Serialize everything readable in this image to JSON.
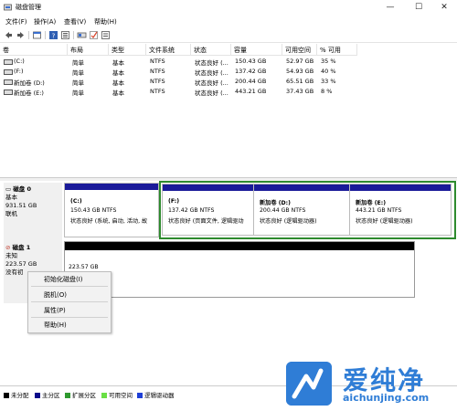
{
  "window": {
    "title": "磁盘管理",
    "minimize": "—",
    "maximize": "☐",
    "close": "✕"
  },
  "menu": [
    "文件(F)",
    "操作(A)",
    "查看(V)",
    "帮助(H)"
  ],
  "toolbar_icons": [
    "back-icon",
    "forward-icon",
    "properties-icon",
    "help-icon",
    "refresh-icon",
    "rescan-icon",
    "check-icon",
    "list-icon"
  ],
  "columns": [
    "卷",
    "布局",
    "类型",
    "文件系统",
    "状态",
    "容量",
    "可用空间",
    "% 可用"
  ],
  "volumes": [
    [
      "(C:)",
      "简单",
      "基本",
      "NTFS",
      "状态良好 (...",
      "150.43 GB",
      "52.97 GB",
      "35 %"
    ],
    [
      "(F:)",
      "简单",
      "基本",
      "NTFS",
      "状态良好 (...",
      "137.42 GB",
      "54.93 GB",
      "40 %"
    ],
    [
      "新加卷 (D:)",
      "简单",
      "基本",
      "NTFS",
      "状态良好 (...",
      "200.44 GB",
      "65.51 GB",
      "33 %"
    ],
    [
      "新加卷 (E:)",
      "简单",
      "基本",
      "NTFS",
      "状态良好 (...",
      "443.21 GB",
      "37.43 GB",
      "8 %"
    ]
  ],
  "disk0": {
    "name": "磁盘 0",
    "type": "基本",
    "size": "931.51 GB",
    "status": "联机",
    "partitions": [
      {
        "name": "(C:)",
        "size": "150.43 GB NTFS",
        "status": "状态良好 (系统, 启动, 活动, 故"
      },
      {
        "name": "(F:)",
        "size": "137.42 GB NTFS",
        "status": "状态良好 (页面文件, 逻辑驱动"
      },
      {
        "name": "新加卷  (D:)",
        "size": "200.44 GB NTFS",
        "status": "状态良好 (逻辑驱动器)"
      },
      {
        "name": "新加卷  (E:)",
        "size": "443.21 GB NTFS",
        "status": "状态良好 (逻辑驱动器)"
      }
    ]
  },
  "disk1": {
    "name": "磁盘 1",
    "type": "未知",
    "size": "223.57 GB",
    "status": "没有初",
    "unallocated": "223.57 GB"
  },
  "context_menu": [
    "初始化磁盘(I)",
    "脱机(O)",
    "属性(P)",
    "帮助(H)"
  ],
  "legend": [
    {
      "label": "未分配",
      "color": "#000000"
    },
    {
      "label": "主分区",
      "color": "#0a0a8a"
    },
    {
      "label": "扩展分区",
      "color": "#2f9a2f"
    },
    {
      "label": "可用空间",
      "color": "#6adf45"
    },
    {
      "label": "逻辑驱动器",
      "color": "#1e3fd6"
    }
  ],
  "watermark": {
    "brand": "爱纯净",
    "url": "aichunjing.com"
  },
  "colors": {
    "primary": "#1a1a99",
    "unallocated": "#000000",
    "selection": "#2e8a2e",
    "watermark": "#2f7dd6"
  }
}
